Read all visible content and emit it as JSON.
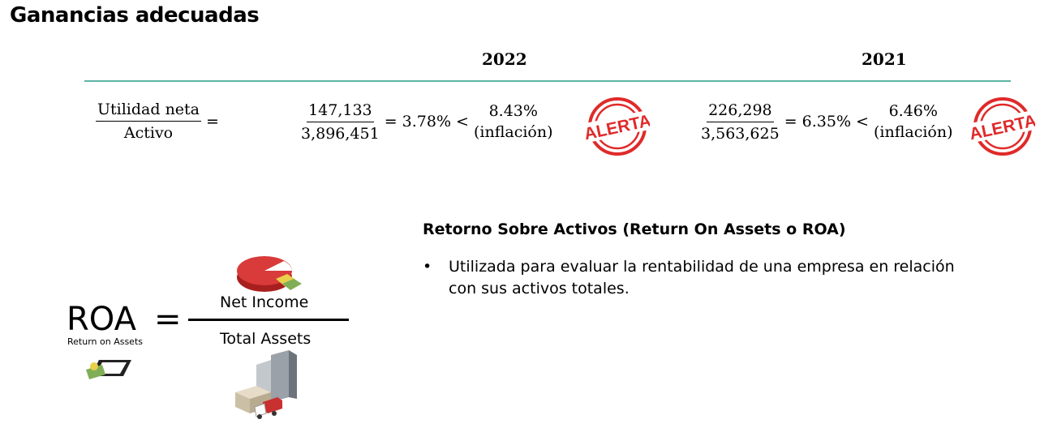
{
  "title": "Ganancias adecuadas",
  "years": [
    "2022",
    "2021"
  ],
  "formula": {
    "numerator": "Utilidad neta",
    "denominator": "Activo",
    "equals": "="
  },
  "calc_2022": {
    "numerator": "147,133",
    "denominator": "3,896,451",
    "result": "= 3.78% <",
    "compare_value": "8.43%",
    "compare_label": "(inflación)",
    "stamp": "ALERTA"
  },
  "calc_2021": {
    "numerator": "226,298",
    "denominator": "3,563,625",
    "result": "= 6.35% <",
    "compare_value": "6.46%",
    "compare_label": "(inflación)",
    "stamp": "ALERTA"
  },
  "roa": {
    "symbol": "ROA",
    "subtitle": "Return on Assets",
    "equals": "=",
    "numerator": "Net Income",
    "denominator": "Total Assets"
  },
  "section": {
    "heading": "Retorno Sobre Activos (Return On Assets o ROA)",
    "bullets": [
      "Utilizada para evaluar la rentabilidad de una empresa en relación con sus activos totales."
    ]
  },
  "colors": {
    "rule": "#5fb3a6",
    "stamp": "#e02a2a"
  },
  "icons": [
    "alert-stamp-icon",
    "pie-chart-icon",
    "money-icon",
    "buildings-icon"
  ]
}
